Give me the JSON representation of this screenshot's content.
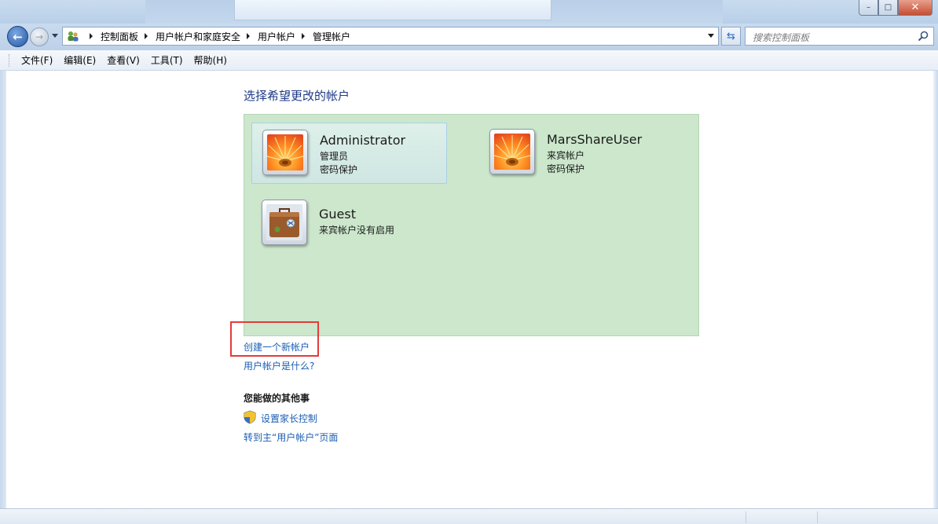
{
  "window": {
    "minimize_glyph": "–",
    "maximize_glyph": "□",
    "close_glyph": "✕"
  },
  "nav": {
    "back_glyph": "←",
    "forward_glyph": "→",
    "refresh_glyph": "⇆"
  },
  "breadcrumb": {
    "items": [
      "控制面板",
      "用户帐户和家庭安全",
      "用户帐户",
      "管理帐户"
    ]
  },
  "search": {
    "placeholder": "搜索控制面板"
  },
  "menu": {
    "items": [
      "文件(F)",
      "编辑(E)",
      "查看(V)",
      "工具(T)",
      "帮助(H)"
    ]
  },
  "main": {
    "heading": "选择希望更改的帐户",
    "accounts": [
      {
        "name": "Administrator",
        "lines": [
          "管理员",
          "密码保护"
        ],
        "picture": "flower-icon",
        "selected": true
      },
      {
        "name": "MarsShareUser",
        "lines": [
          "来宾帐户",
          "密码保护"
        ],
        "picture": "flower-icon",
        "selected": false
      },
      {
        "name": "Guest",
        "lines": [
          "来宾帐户没有启用"
        ],
        "picture": "suitcase-icon",
        "selected": false
      }
    ],
    "create_account_link": "创建一个新帐户",
    "what_is_link": "用户帐户是什么?",
    "other_heading": "您能做的其他事",
    "parental_control_link": "设置家长控制",
    "go_main_link": "转到主“用户帐户”页面"
  },
  "colors": {
    "panel_bg": "#cce7cc",
    "link": "#1b5eb4",
    "heading": "#1e3a87",
    "highlight": "#e53a3a"
  }
}
